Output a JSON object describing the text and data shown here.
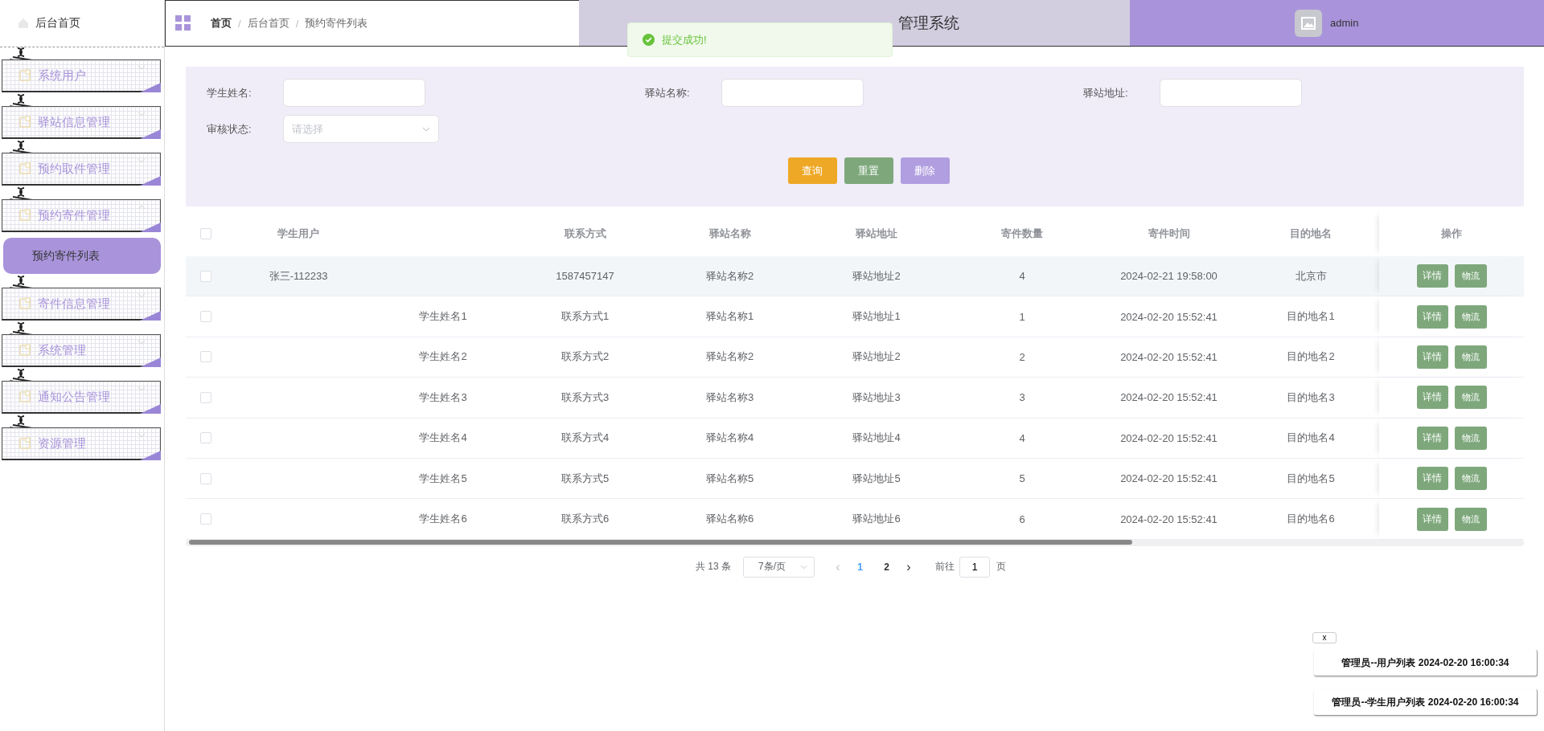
{
  "sidebar": {
    "home": {
      "label": "后台首页"
    },
    "menus": [
      {
        "label": "系统用户",
        "expanded": false
      },
      {
        "label": "驿站信息管理",
        "expanded": false
      },
      {
        "label": "预约取件管理",
        "expanded": false
      },
      {
        "label": "预约寄件管理",
        "expanded": true,
        "children": [
          {
            "label": "预约寄件列表",
            "selected": true
          }
        ]
      },
      {
        "label": "寄件信息管理",
        "expanded": false
      },
      {
        "label": "系统管理",
        "expanded": false
      },
      {
        "label": "通知公告管理",
        "expanded": false
      },
      {
        "label": "资源管理",
        "expanded": false
      }
    ]
  },
  "header": {
    "breadcrumb": [
      "首页",
      "后台首页",
      "预约寄件列表"
    ],
    "breadcrumb_separators": [
      "/",
      "/"
    ],
    "title": "管理系统",
    "user": "admin"
  },
  "toast": {
    "message": "提交成功!"
  },
  "search": {
    "fields": [
      {
        "label": "学生姓名:",
        "kind": "input"
      },
      {
        "label": "驿站名称:",
        "kind": "input"
      },
      {
        "label": "驿站地址:",
        "kind": "input"
      },
      {
        "label": "审核状态:",
        "kind": "select",
        "placeholder": "请选择"
      }
    ],
    "buttons": [
      {
        "label": "查询",
        "color": "#eea826"
      },
      {
        "label": "重置",
        "color": "#7ea87c"
      },
      {
        "label": "删除",
        "color": "#b09ee0"
      }
    ]
  },
  "table": {
    "header_checked": false,
    "columns": [
      "学生用户",
      "",
      "联系方式",
      "驿站名称",
      "驿站地址",
      "寄件数量",
      "寄件时间",
      "目的地名",
      "操作"
    ],
    "rows": [
      {
        "checked": false,
        "highlighted": true,
        "cells": [
          "张三-112233",
          "",
          "1587457147",
          "驿站名称2",
          "驿站地址2",
          "4",
          "2024-02-21 19:58:00",
          "北京市"
        ],
        "actions": [
          "详情",
          "物流"
        ]
      },
      {
        "checked": false,
        "highlighted": false,
        "cells": [
          "",
          "学生姓名1",
          "联系方式1",
          "驿站名称1",
          "驿站地址1",
          "1",
          "2024-02-20 15:52:41",
          "目的地名1"
        ],
        "actions": [
          "详情",
          "物流"
        ]
      },
      {
        "checked": false,
        "highlighted": false,
        "cells": [
          "",
          "学生姓名2",
          "联系方式2",
          "驿站名称2",
          "驿站地址2",
          "2",
          "2024-02-20 15:52:41",
          "目的地名2"
        ],
        "actions": [
          "详情",
          "物流"
        ]
      },
      {
        "checked": false,
        "highlighted": false,
        "cells": [
          "",
          "学生姓名3",
          "联系方式3",
          "驿站名称3",
          "驿站地址3",
          "3",
          "2024-02-20 15:52:41",
          "目的地名3"
        ],
        "actions": [
          "详情",
          "物流"
        ]
      },
      {
        "checked": false,
        "highlighted": false,
        "cells": [
          "",
          "学生姓名4",
          "联系方式4",
          "驿站名称4",
          "驿站地址4",
          "4",
          "2024-02-20 15:52:41",
          "目的地名4"
        ],
        "actions": [
          "详情",
          "物流"
        ]
      },
      {
        "checked": false,
        "highlighted": false,
        "cells": [
          "",
          "学生姓名5",
          "联系方式5",
          "驿站名称5",
          "驿站地址5",
          "5",
          "2024-02-20 15:52:41",
          "目的地名5"
        ],
        "actions": [
          "详情",
          "物流"
        ]
      },
      {
        "checked": false,
        "highlighted": false,
        "cells": [
          "",
          "学生姓名6",
          "联系方式6",
          "驿站名称6",
          "驿站地址6",
          "6",
          "2024-02-20 15:52:41",
          "目的地名6"
        ],
        "actions": [
          "详情",
          "物流"
        ]
      }
    ]
  },
  "pagination": {
    "total": "共 13 条",
    "page_size": "7条/页",
    "prev": "‹",
    "next": "›",
    "pages": [
      {
        "label": "1",
        "selected": true
      },
      {
        "label": "2",
        "selected": false
      }
    ],
    "goto_label": "前往",
    "goto_value": "1",
    "goto_suffix": "页"
  },
  "notices": {
    "close": "x",
    "items": [
      "管理员--用户列表 2024-02-20 16:00:34",
      "管理员--学生用户列表 2024-02-20 16:00:34"
    ]
  }
}
